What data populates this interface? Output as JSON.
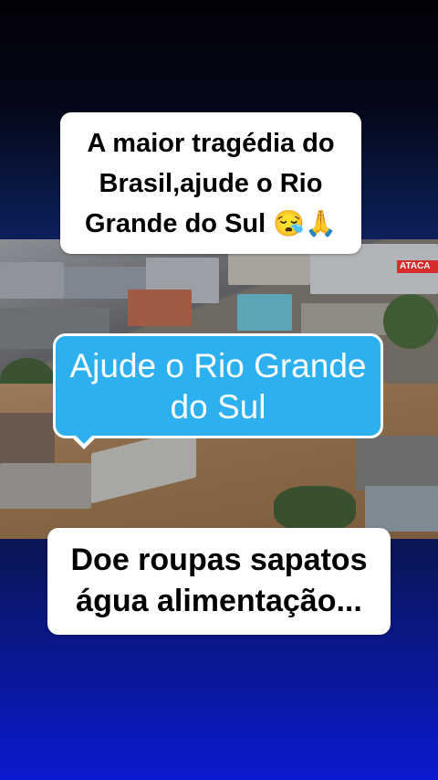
{
  "caption_top": {
    "line1": "A maior tragédia do",
    "line2": "Brasil,ajude o Rio",
    "line3": "Grande do Sul",
    "emoji": "😪🙏"
  },
  "caption_middle": {
    "line1": "Ajude o Rio Grande",
    "line2": "do Sul"
  },
  "caption_bottom": {
    "line1": "Doe roupas sapatos",
    "line2": "água alimentação..."
  },
  "photo": {
    "sign_text": "ATACA"
  },
  "colors": {
    "bubble_blue": "#2db0f0",
    "background_dark": "#020206",
    "background_blue": "#0a1ad0"
  }
}
